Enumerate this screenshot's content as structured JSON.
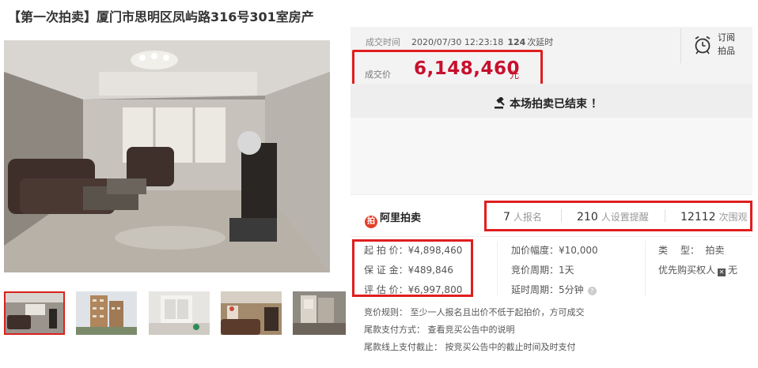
{
  "title": "【第一次拍卖】厦门市思明区凤屿路316号301室房产",
  "deal": {
    "time_label": "成交时间",
    "time_value": "2020/07/30 12:23:18",
    "delay_count": "124",
    "delay_label": "次延时",
    "price_label": "成交价",
    "price_value": "6,148,460",
    "price_unit": "元"
  },
  "subscribe": {
    "label": "订阅拍品",
    "icon": "alarm-clock-icon"
  },
  "status": {
    "text": "本场拍卖已结束 ！",
    "icon": "hammer-icon"
  },
  "brand": {
    "name": "阿里拍卖",
    "logo_char": "拍"
  },
  "stats": {
    "signups_num": "7",
    "signups_label": "人报名",
    "reminders_num": "210",
    "reminders_label": "人设置提醒",
    "views_num": "12112",
    "views_label": "次围观"
  },
  "info": {
    "start_price": "起 拍 价：¥4,898,460",
    "deposit": "保 证 金：¥489,846",
    "appraisal": "评 估 价：¥6,997,800",
    "increment": "加价幅度：¥10,000",
    "period": "竞价周期：1天",
    "delay_period": "延时周期：5分钟",
    "type_label": "类　 型：",
    "type_value": "拍卖",
    "priority_label": "优先购买权人",
    "priority_value": "无"
  },
  "rules": {
    "bidding_rule": "竞价规则： 至少一人报名且出价不低于起拍价，方可成交",
    "payment_method": "尾款支付方式： 查看竞买公告中的说明",
    "payment_deadline": "尾款线上支付截止： 按竞买公告中的截止时间及时支付"
  },
  "colors": {
    "accent_red": "#c8102e",
    "box_red": "#e01e1e",
    "logo_red": "#e43f2a"
  }
}
